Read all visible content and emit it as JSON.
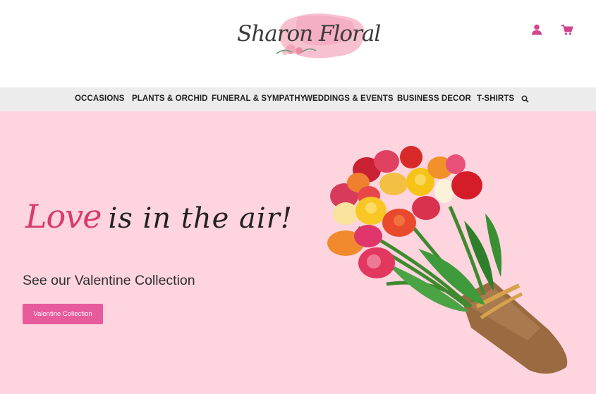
{
  "header": {
    "logo_text": "Sharon Floral",
    "icons": [
      "user-icon",
      "cart-icon"
    ]
  },
  "nav": {
    "items": [
      {
        "label": "OCCASIONS"
      },
      {
        "label": "PLANTS & ORCHID"
      },
      {
        "label": "FUNERAL & SYMPATHY"
      },
      {
        "label": "WEDDINGS & EVENTS"
      },
      {
        "label": "BUSINESS DECOR"
      },
      {
        "label": "T-SHIRTS"
      }
    ],
    "search_icon": "search-icon"
  },
  "hero": {
    "headline_accent": "Love",
    "headline_rest": "is in the air!",
    "subheading": "See our Valentine Collection",
    "cta_label": "Valentine Collection",
    "image": "tulip-bouquet"
  },
  "colors": {
    "accent": "#e75a9c",
    "hero_bg": "#fed4df",
    "nav_bg": "#ececec",
    "headline_accent": "#d63c6a",
    "icon": "#d2458a"
  }
}
